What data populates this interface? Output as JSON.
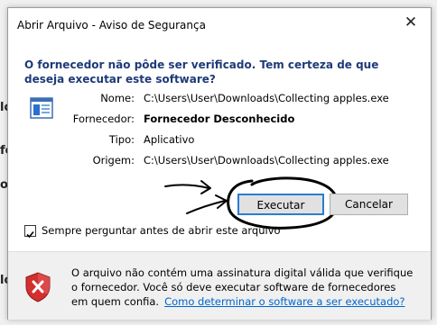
{
  "window": {
    "title": "Abrir Arquivo - Aviso de Segurança",
    "close_glyph": "✕"
  },
  "background": {
    "fragments": [
      "lo",
      "fo",
      "or",
      "lo"
    ]
  },
  "question": "O fornecedor não pôde ser verificado. Tem certeza de que deseja executar este software?",
  "file_icon": "program-file-icon",
  "details": {
    "name_label": "Nome:",
    "name_value": "C:\\Users\\User\\Downloads\\Collecting apples.exe",
    "publisher_label": "Fornecedor:",
    "publisher_value": "Fornecedor Desconhecido",
    "type_label": "Tipo:",
    "type_value": "Aplicativo",
    "origin_label": "Origem:",
    "origin_value": "C:\\Users\\User\\Downloads\\Collecting apples.exe"
  },
  "buttons": {
    "run": "Executar",
    "cancel": "Cancelar"
  },
  "checkbox": {
    "label": "Sempre perguntar antes de abrir este arquivo",
    "checked": true
  },
  "footer": {
    "icon": "security-warning-shield-icon",
    "text": "O arquivo não contém uma assinatura digital válida que verifique o fornecedor. Você só deve executar software de fornecedores em quem confia.",
    "link": "Como determinar o software a ser executado?"
  },
  "colors": {
    "accent": "#2b7cd3",
    "question_text": "#1e3a78",
    "link": "#0066cc",
    "shield_red": "#d32f2f",
    "annotation_ink": "#000000"
  }
}
